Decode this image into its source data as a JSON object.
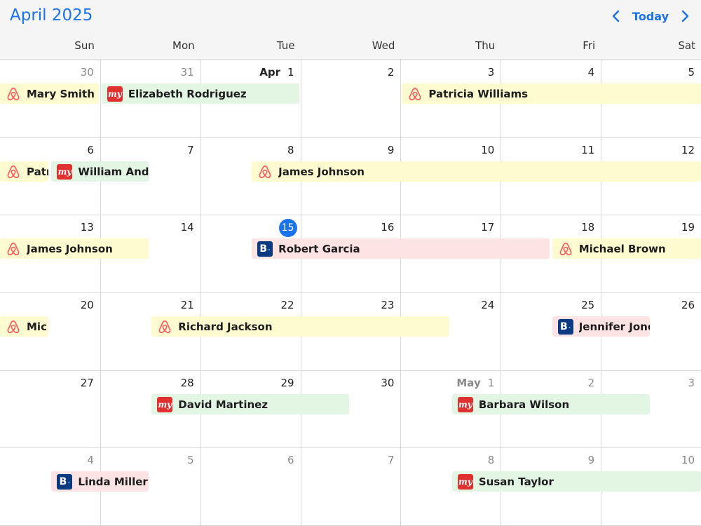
{
  "header": {
    "title": "April 2025",
    "today_label": "Today",
    "weekdays": [
      "Sun",
      "Mon",
      "Tue",
      "Wed",
      "Thu",
      "Fri",
      "Sat"
    ]
  },
  "calendar": {
    "today_day": "15",
    "weeks": [
      [
        {
          "d": "30",
          "other": true
        },
        {
          "d": "31",
          "other": true
        },
        {
          "d": "1",
          "month": "Apr"
        },
        {
          "d": "2"
        },
        {
          "d": "3"
        },
        {
          "d": "4"
        },
        {
          "d": "5"
        }
      ],
      [
        {
          "d": "6"
        },
        {
          "d": "7"
        },
        {
          "d": "8"
        },
        {
          "d": "9"
        },
        {
          "d": "10"
        },
        {
          "d": "11"
        },
        {
          "d": "12"
        }
      ],
      [
        {
          "d": "13"
        },
        {
          "d": "14"
        },
        {
          "d": "15",
          "today": true
        },
        {
          "d": "16"
        },
        {
          "d": "17"
        },
        {
          "d": "18"
        },
        {
          "d": "19"
        }
      ],
      [
        {
          "d": "20"
        },
        {
          "d": "21"
        },
        {
          "d": "22"
        },
        {
          "d": "23"
        },
        {
          "d": "24"
        },
        {
          "d": "25"
        },
        {
          "d": "26"
        }
      ],
      [
        {
          "d": "27"
        },
        {
          "d": "28"
        },
        {
          "d": "29"
        },
        {
          "d": "30"
        },
        {
          "d": "1",
          "month": "May",
          "other": true
        },
        {
          "d": "2",
          "other": true
        },
        {
          "d": "3",
          "other": true
        }
      ],
      [
        {
          "d": "4",
          "other": true
        },
        {
          "d": "5",
          "other": true
        },
        {
          "d": "6",
          "other": true
        },
        {
          "d": "7",
          "other": true
        },
        {
          "d": "8",
          "other": true
        },
        {
          "d": "9",
          "other": true
        },
        {
          "d": "10",
          "other": true
        }
      ]
    ]
  },
  "events": [
    {
      "name": "Mary Smith",
      "source": "airbnb-icon",
      "type": "airbnb",
      "week": 0,
      "start": 0,
      "end": 1
    },
    {
      "name": "Elizabeth Rodriguez",
      "source": "makemytrip-icon",
      "type": "mmt",
      "week": 0,
      "start": 1,
      "end": 3
    },
    {
      "name": "Patricia Williams",
      "source": "airbnb-icon",
      "type": "airbnb",
      "week": 0,
      "start": 4,
      "end": 7
    },
    {
      "name": "Patr",
      "source": "airbnb-icon",
      "type": "airbnb",
      "week": 1,
      "start": 0,
      "end": 0.5
    },
    {
      "name": "William Ande",
      "source": "makemytrip-icon",
      "type": "mmt",
      "week": 1,
      "start": 0.5,
      "end": 1.5
    },
    {
      "name": "James Johnson",
      "source": "airbnb-icon",
      "type": "airbnb",
      "week": 1,
      "start": 2.5,
      "end": 7
    },
    {
      "name": "James Johnson",
      "source": "airbnb-icon",
      "type": "airbnb",
      "week": 2,
      "start": 0,
      "end": 1.5
    },
    {
      "name": "Robert Garcia",
      "source": "booking-icon",
      "type": "booking",
      "week": 2,
      "start": 2.5,
      "end": 5.5
    },
    {
      "name": "Michael Brown",
      "source": "airbnb-icon",
      "type": "airbnb",
      "week": 2,
      "start": 5.5,
      "end": 7
    },
    {
      "name": "Mic",
      "source": "airbnb-icon",
      "type": "airbnb",
      "week": 3,
      "start": 0,
      "end": 0.5
    },
    {
      "name": "Richard Jackson",
      "source": "airbnb-icon",
      "type": "airbnb",
      "week": 3,
      "start": 1.5,
      "end": 4.5
    },
    {
      "name": "Jennifer Jones",
      "source": "booking-icon",
      "type": "booking",
      "week": 3,
      "start": 5.5,
      "end": 6.5
    },
    {
      "name": "David Martinez",
      "source": "makemytrip-icon",
      "type": "mmt",
      "week": 4,
      "start": 1.5,
      "end": 3.5
    },
    {
      "name": "Barbara Wilson",
      "source": "makemytrip-icon",
      "type": "mmt",
      "week": 4,
      "start": 4.5,
      "end": 6.5
    },
    {
      "name": "Linda Miller",
      "source": "booking-icon",
      "type": "booking",
      "week": 5,
      "start": 0.5,
      "end": 1.5
    },
    {
      "name": "Susan Taylor",
      "source": "makemytrip-icon",
      "type": "mmt",
      "week": 5,
      "start": 4.5,
      "end": 7
    }
  ],
  "colors": {
    "accent": "#1a73e8",
    "airbnb_bg": "#fefbd0",
    "makemytrip_bg": "#e3f6e4",
    "booking_bg": "#fde3e4",
    "airbnb_icon": "#ff5a5f"
  }
}
